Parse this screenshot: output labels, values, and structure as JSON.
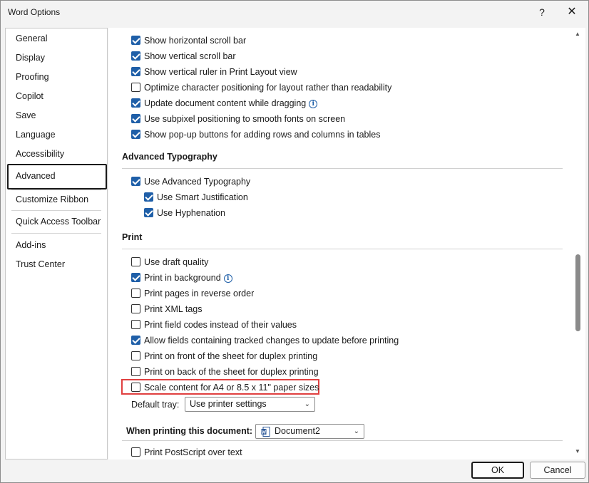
{
  "window": {
    "title": "Word Options",
    "help_glyph": "?",
    "close_glyph": "✕"
  },
  "nav": {
    "items": [
      {
        "label": "General"
      },
      {
        "label": "Display"
      },
      {
        "label": "Proofing"
      },
      {
        "label": "Copilot"
      },
      {
        "label": "Save"
      },
      {
        "label": "Language"
      },
      {
        "label": "Accessibility"
      },
      {
        "label": "Advanced",
        "selected": true
      },
      {
        "label": "Customize Ribbon"
      },
      {
        "label": "Quick Access Toolbar"
      },
      {
        "label": "Add-ins"
      },
      {
        "label": "Trust Center"
      }
    ]
  },
  "display_options": [
    {
      "label": "Show horizontal scroll bar",
      "checked": true
    },
    {
      "label": "Show vertical scroll bar",
      "checked": true
    },
    {
      "label": "Show vertical ruler in Print Layout view",
      "checked": true
    },
    {
      "label": "Optimize character positioning for layout rather than readability",
      "checked": false
    },
    {
      "label": "Update document content while dragging",
      "checked": true,
      "info": true
    },
    {
      "label": "Use subpixel positioning to smooth fonts on screen",
      "checked": true
    },
    {
      "label": "Show pop-up buttons for adding rows and columns in tables",
      "checked": true
    }
  ],
  "typography": {
    "heading": "Advanced Typography",
    "options": [
      {
        "label": "Use Advanced Typography",
        "checked": true
      },
      {
        "label": "Use Smart Justification",
        "checked": true
      },
      {
        "label": "Use Hyphenation",
        "checked": true
      }
    ]
  },
  "print": {
    "heading": "Print",
    "options": [
      {
        "label": "Use draft quality",
        "checked": false
      },
      {
        "label": "Print in background",
        "checked": true,
        "info": true
      },
      {
        "label": "Print pages in reverse order",
        "checked": false
      },
      {
        "label": "Print XML tags",
        "checked": false
      },
      {
        "label": "Print field codes instead of their values",
        "checked": false
      },
      {
        "label": "Allow fields containing tracked changes to update before printing",
        "checked": true
      },
      {
        "label": "Print on front of the sheet for duplex printing",
        "checked": false
      },
      {
        "label": "Print on back of the sheet for duplex printing",
        "checked": false
      },
      {
        "label": "Scale content for A4 or 8.5 x 11\" paper sizes",
        "checked": false,
        "highlighted": true
      }
    ],
    "default_tray_label": "Default tray:",
    "default_tray_value": "Use printer settings"
  },
  "when_printing": {
    "label": "When printing this document:",
    "document": "Document2",
    "options": [
      {
        "label": "Print PostScript over text",
        "checked": false
      }
    ]
  },
  "buttons": {
    "ok": "OK",
    "cancel": "Cancel"
  },
  "colors": {
    "accent": "#1f5fa8",
    "highlight": "#e04040"
  },
  "icons": {
    "info": "info-icon",
    "checkbox": "checkbox",
    "dropdown": "chevron-down-icon",
    "document": "word-document-icon"
  }
}
